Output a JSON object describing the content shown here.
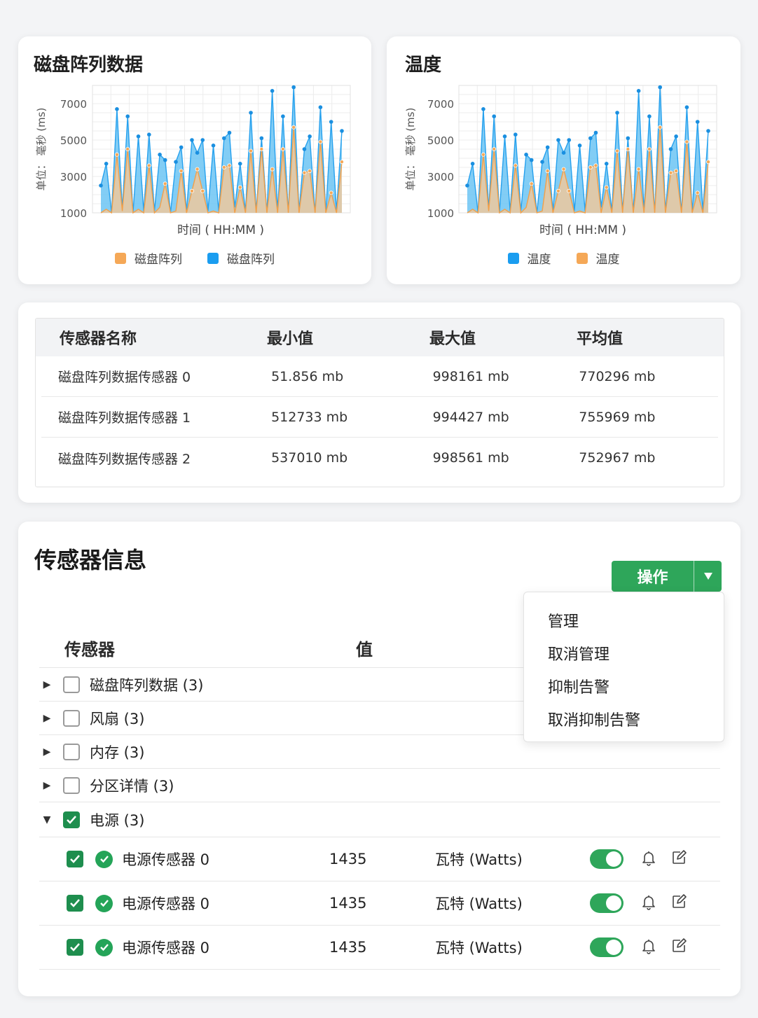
{
  "charts": {
    "left": {
      "title": "磁盘阵列数据",
      "legend": [
        {
          "label": "磁盘阵列",
          "color": "#f5a857"
        },
        {
          "label": "磁盘阵列",
          "color": "#1a9df0"
        }
      ]
    },
    "right": {
      "title": "温度",
      "legend": [
        {
          "label": "温度",
          "color": "#1a9df0"
        },
        {
          "label": "温度",
          "color": "#f5a857"
        }
      ]
    }
  },
  "chart_data": [
    {
      "type": "area",
      "title": "磁盘阵列数据",
      "xlabel": "时间 ( HH:MM )",
      "ylabel": "单位： 毫秒 (ms)",
      "yticks": [
        1000,
        3000,
        5000,
        7000
      ],
      "ylim": [
        1000,
        8000
      ],
      "grid": true,
      "legend_position": "bottom",
      "series": [
        {
          "name": "磁盘阵列",
          "color": "#1a9df0",
          "values": [
            2500,
            3700,
            1000,
            6700,
            1200,
            6300,
            1000,
            5200,
            1100,
            5300,
            1100,
            4200,
            3900,
            1000,
            3800,
            4600,
            1100,
            5000,
            4300,
            5000,
            1100,
            4700,
            1100,
            5100,
            5400,
            1300,
            3700,
            1100,
            6500,
            1100,
            5100,
            1000,
            7700,
            1100,
            6300,
            1000,
            7900,
            1100,
            4500,
            5200,
            1000,
            6800,
            1000,
            6000,
            1100,
            5500
          ]
        },
        {
          "name": "磁盘阵列",
          "color": "#f5a857",
          "values": [
            1000,
            1200,
            1000,
            4200,
            1100,
            4500,
            1000,
            1200,
            1000,
            3600,
            1000,
            1300,
            2600,
            1000,
            1100,
            3300,
            1000,
            2200,
            3400,
            2200,
            1000,
            1100,
            1000,
            3500,
            3600,
            1000,
            2400,
            1000,
            4400,
            1000,
            4500,
            1000,
            3400,
            1000,
            4500,
            1000,
            5700,
            1000,
            3200,
            3300,
            1000,
            4900,
            1000,
            2100,
            1000,
            3800
          ]
        }
      ]
    },
    {
      "type": "area",
      "title": "温度",
      "xlabel": "时间 ( HH:MM )",
      "ylabel": "单位： 毫秒 (ms)",
      "yticks": [
        1000,
        3000,
        5000,
        7000
      ],
      "ylim": [
        1000,
        8000
      ],
      "grid": true,
      "legend_position": "bottom",
      "series": [
        {
          "name": "温度",
          "color": "#1a9df0",
          "values": [
            2500,
            3700,
            1000,
            6700,
            1200,
            6300,
            1000,
            5200,
            1100,
            5300,
            1100,
            4200,
            3900,
            1000,
            3800,
            4600,
            1100,
            5000,
            4300,
            5000,
            1100,
            4700,
            1100,
            5100,
            5400,
            1300,
            3700,
            1100,
            6500,
            1100,
            5100,
            1000,
            7700,
            1100,
            6300,
            1000,
            7900,
            1100,
            4500,
            5200,
            1000,
            6800,
            1000,
            6000,
            1100,
            5500
          ]
        },
        {
          "name": "温度",
          "color": "#f5a857",
          "values": [
            1000,
            1200,
            1000,
            4200,
            1100,
            4500,
            1000,
            1200,
            1000,
            3600,
            1000,
            1300,
            2600,
            1000,
            1100,
            3300,
            1000,
            2200,
            3400,
            2200,
            1000,
            1100,
            1000,
            3500,
            3600,
            1000,
            2400,
            1000,
            4400,
            1000,
            4500,
            1000,
            3400,
            1000,
            4500,
            1000,
            5700,
            1000,
            3200,
            3300,
            1000,
            4900,
            1000,
            2100,
            1000,
            3800
          ]
        }
      ]
    }
  ],
  "stats": {
    "headers": [
      "传感器名称",
      "最小值",
      "最大值",
      "平均值"
    ],
    "rows": [
      [
        "磁盘阵列数据传感器 0",
        "51.856 mb",
        "998161 mb",
        "770296 mb"
      ],
      [
        "磁盘阵列数据传感器 1",
        "512733 mb",
        "994427 mb",
        "755969 mb"
      ],
      [
        "磁盘阵列数据传感器 2",
        "537010 mb",
        "998561 mb",
        "752967 mb"
      ]
    ]
  },
  "sensors": {
    "title": "传感器信息",
    "action_label": "操作",
    "menu": [
      "管理",
      "取消管理",
      "抑制告警",
      "取消抑制告警"
    ],
    "headers": {
      "sensor": "传感器",
      "value": "值"
    },
    "groups": [
      {
        "label": "磁盘阵列数据 (3)",
        "expanded": false,
        "checked": false
      },
      {
        "label": "风扇 (3)",
        "expanded": false,
        "checked": false
      },
      {
        "label": "内存 (3)",
        "expanded": false,
        "checked": false
      },
      {
        "label": "分区详情 (3)",
        "expanded": false,
        "checked": false
      },
      {
        "label": "电源 (3)",
        "expanded": true,
        "checked": true
      }
    ],
    "children": [
      {
        "name": "电源传感器 0",
        "value": "1435",
        "unit": "瓦特 (Watts)",
        "enabled": true
      },
      {
        "name": "电源传感器 0",
        "value": "1435",
        "unit": "瓦特 (Watts)",
        "enabled": true
      },
      {
        "name": "电源传感器 0",
        "value": "1435",
        "unit": "瓦特 (Watts)",
        "enabled": true
      }
    ],
    "colors": {
      "accent": "#2ea65a",
      "checkbox": "#1e8e4e"
    }
  }
}
